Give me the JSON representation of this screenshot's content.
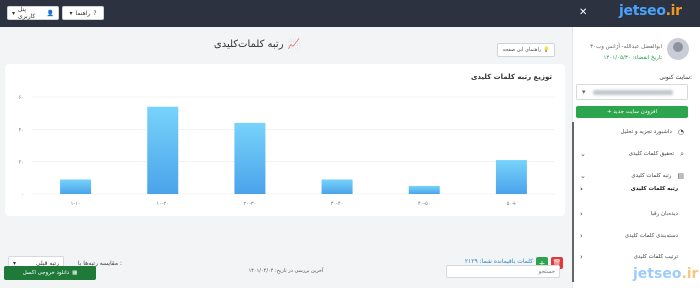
{
  "topbar": {
    "user_panel_label": "پنل کاربری",
    "guide_label": "راهنما",
    "close_icon": "close-icon",
    "logo_main": "jetseo",
    "logo_ext": ".ir"
  },
  "sidebar": {
    "user_name": "ابوالفضل عبدالله- آژانس وب٣٠",
    "expire": "تاریخ انقضاء: ۱۴۰۱/۰۵/۳۰",
    "site_label": "سایت کنونی:",
    "add_site_label": "+ افزودن سایت جدید",
    "items": [
      {
        "label": "داشبورد تجزیه و تحلیل",
        "icon": "gauge-icon"
      },
      {
        "label": "تحقیق کلمات کلیدی",
        "icon": "search-icon"
      },
      {
        "label": "رتبه کلمات کلیدی",
        "icon": "chart-icon"
      },
      {
        "label": "رتبه کلمات کلیدی"
      },
      {
        "label": "دیده‌بان رقبا"
      },
      {
        "label": "دسته‌بندی کلمات کلیدی"
      },
      {
        "label": "ترتیب کلمات کلیدی"
      }
    ]
  },
  "main": {
    "title": "رتبه کلمات‌کلیدی",
    "help_label": "راهنمای این صفحه",
    "chart_title": "توزیع رتبه کلمات کلیدی",
    "compare_label": "مقایسه رتبه‌ها با :",
    "compare_value": "رتبه قبلی",
    "remaining": "کلمات باقیمانده شما: ۲۱۲۹",
    "search_placeholder": "جستجو",
    "last_check": "آخرین بررسی در تاریخ: ۱۴۰۱/۰۴/۰۴",
    "excel_label": "دانلود خروجی اکسل"
  },
  "watermark": {
    "main": "jetseo",
    "ext": ".ir"
  },
  "colors": {
    "accent": "#4aa3ff",
    "bar": "#5bb8f0",
    "green": "#2da44e",
    "red": "#e23a3a",
    "topbar": "#2d3240"
  },
  "chart_data": {
    "type": "bar",
    "title": "توزیع رتبه کلمات کلیدی",
    "categories": [
      "۱-۱۰",
      "۱۰-۲۰",
      "۲۰-۳۰",
      "۳۰-۴۰",
      "۴۰-۵۰",
      "۵۰+"
    ],
    "values": [
      9,
      54,
      44,
      9,
      5,
      21
    ],
    "ylim": [
      0,
      60
    ],
    "yticks": [
      "۰",
      "۲۰",
      "۴۰",
      "۶۰"
    ],
    "grid": true
  }
}
